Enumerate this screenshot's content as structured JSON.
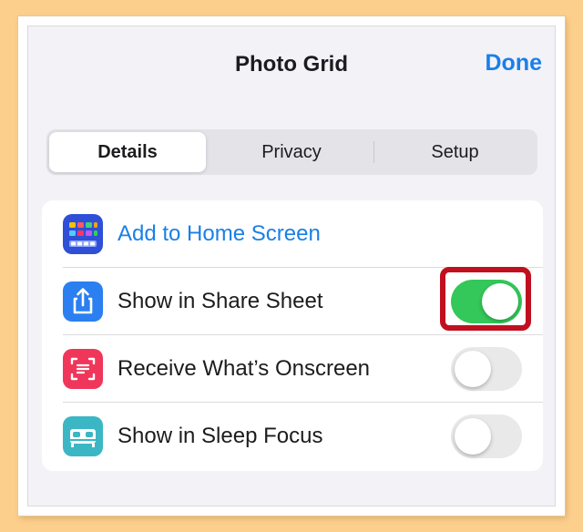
{
  "header": {
    "title": "Photo Grid",
    "done_label": "Done"
  },
  "segments": [
    {
      "label": "Details",
      "selected": true
    },
    {
      "label": "Privacy",
      "selected": false
    },
    {
      "label": "Setup",
      "selected": false
    }
  ],
  "rows": [
    {
      "label": "Add to Home Screen",
      "icon": "home-screen-grid-icon",
      "icon_color": "#2e4fd6",
      "is_link": true
    },
    {
      "label": "Show in Share Sheet",
      "icon": "share-icon",
      "icon_color": "#2b7ff0",
      "toggle_on": true,
      "highlighted": true
    },
    {
      "label": "Receive What’s Onscreen",
      "icon": "screen-text-icon",
      "icon_color": "#f0365a",
      "toggle_on": false
    },
    {
      "label": "Show in Sleep Focus",
      "icon": "bed-icon",
      "icon_color": "#3bb6c4",
      "toggle_on": false
    }
  ],
  "colors": {
    "accent": "#1a7fe8",
    "toggle_on": "#34c759",
    "toggle_off": "#e9e9ea",
    "highlight_box": "#c0101f",
    "backdrop": "#fdcf8c"
  }
}
